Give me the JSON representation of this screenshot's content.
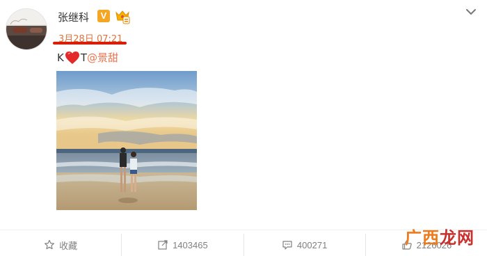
{
  "post": {
    "username": "张继科",
    "verified_mark": "V",
    "timestamp": "3月28日 07:21",
    "text_left": "K",
    "text_right": "T",
    "mention": "@景甜",
    "icons": {
      "avatar": "user-avatar",
      "verified": "verified-v-badge",
      "member": "member-crown-badge",
      "more": "chevron-down-icon",
      "heart": "heart-emoji"
    },
    "colors": {
      "timestamp": "#e0723c",
      "underline": "#d81e06",
      "mention": "#eb7350",
      "verified": "#f5a623"
    }
  },
  "actions": [
    {
      "icon": "star-icon",
      "label": "收藏"
    },
    {
      "icon": "repost-icon",
      "label": "1403465"
    },
    {
      "icon": "comment-icon",
      "label": "400271"
    },
    {
      "icon": "like-icon",
      "label": "2126026"
    }
  ],
  "watermark": {
    "part_a": "广西",
    "part_b": "龙网"
  }
}
